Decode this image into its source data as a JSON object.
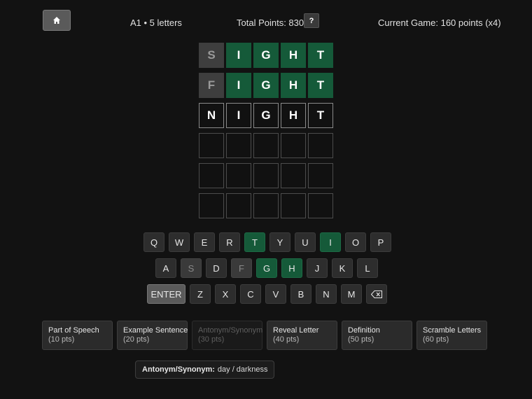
{
  "header": {
    "level": "A1 • 5 letters",
    "total_points": "Total Points: 830",
    "help_label": "?",
    "current_game": "Current Game: 160 points (x4)"
  },
  "icons": {
    "home": "home-icon",
    "backspace": "backspace-icon"
  },
  "colors": {
    "correct": "#155a39",
    "absent": "#3e3e3e",
    "background": "#121212"
  },
  "board": [
    [
      {
        "letter": "S",
        "state": "absent"
      },
      {
        "letter": "I",
        "state": "correct"
      },
      {
        "letter": "G",
        "state": "correct"
      },
      {
        "letter": "H",
        "state": "correct"
      },
      {
        "letter": "T",
        "state": "correct"
      }
    ],
    [
      {
        "letter": "F",
        "state": "absent"
      },
      {
        "letter": "I",
        "state": "correct"
      },
      {
        "letter": "G",
        "state": "correct"
      },
      {
        "letter": "H",
        "state": "correct"
      },
      {
        "letter": "T",
        "state": "correct"
      }
    ],
    [
      {
        "letter": "N",
        "state": "typed"
      },
      {
        "letter": "I",
        "state": "typed"
      },
      {
        "letter": "G",
        "state": "typed"
      },
      {
        "letter": "H",
        "state": "typed"
      },
      {
        "letter": "T",
        "state": "typed"
      }
    ],
    [
      {
        "letter": "",
        "state": "empty"
      },
      {
        "letter": "",
        "state": "empty"
      },
      {
        "letter": "",
        "state": "empty"
      },
      {
        "letter": "",
        "state": "empty"
      },
      {
        "letter": "",
        "state": "empty"
      }
    ],
    [
      {
        "letter": "",
        "state": "empty"
      },
      {
        "letter": "",
        "state": "empty"
      },
      {
        "letter": "",
        "state": "empty"
      },
      {
        "letter": "",
        "state": "empty"
      },
      {
        "letter": "",
        "state": "empty"
      }
    ],
    [
      {
        "letter": "",
        "state": "empty"
      },
      {
        "letter": "",
        "state": "empty"
      },
      {
        "letter": "",
        "state": "empty"
      },
      {
        "letter": "",
        "state": "empty"
      },
      {
        "letter": "",
        "state": "empty"
      }
    ]
  ],
  "keyboard": [
    [
      {
        "label": "Q"
      },
      {
        "label": "W"
      },
      {
        "label": "E"
      },
      {
        "label": "R"
      },
      {
        "label": "T",
        "state": "correct"
      },
      {
        "label": "Y"
      },
      {
        "label": "U"
      },
      {
        "label": "I",
        "state": "correct"
      },
      {
        "label": "O"
      },
      {
        "label": "P"
      }
    ],
    [
      {
        "label": "A"
      },
      {
        "label": "S",
        "state": "absent"
      },
      {
        "label": "D"
      },
      {
        "label": "F",
        "state": "absent"
      },
      {
        "label": "G",
        "state": "correct"
      },
      {
        "label": "H",
        "state": "correct"
      },
      {
        "label": "J"
      },
      {
        "label": "K"
      },
      {
        "label": "L"
      }
    ],
    [
      {
        "label": "ENTER",
        "type": "enter"
      },
      {
        "label": "Z"
      },
      {
        "label": "X"
      },
      {
        "label": "C"
      },
      {
        "label": "V"
      },
      {
        "label": "B"
      },
      {
        "label": "N"
      },
      {
        "label": "M"
      },
      {
        "label": "⌫",
        "type": "backspace"
      }
    ]
  ],
  "hints": [
    {
      "title": "Part of Speech",
      "points": "(10 pts)",
      "used": false
    },
    {
      "title": "Example Sentence",
      "points": "(20 pts)",
      "used": false
    },
    {
      "title": "Antonym/Synonym",
      "points": "(30 pts)",
      "used": true
    },
    {
      "title": "Reveal Letter",
      "points": "(40 pts)",
      "used": false
    },
    {
      "title": "Definition",
      "points": "(50 pts)",
      "used": false
    },
    {
      "title": "Scramble Letters",
      "points": "(60 pts)",
      "used": false
    }
  ],
  "revealed_hint": {
    "label": "Antonym/Synonym:",
    "value": "day / darkness"
  }
}
